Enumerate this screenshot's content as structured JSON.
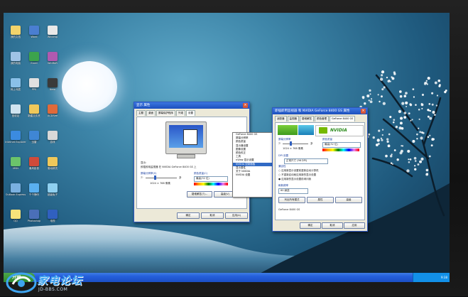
{
  "desktop": {
    "icons": [
      {
        "label": "我的文档",
        "color": "#f2d36b"
      },
      {
        "label": "我的电脑",
        "color": "#9fc3e6"
      },
      {
        "label": "网上邻居",
        "color": "#8ac0e8"
      },
      {
        "label": "回收站",
        "color": "#cfe3f0"
      },
      {
        "label": "Internet Explorer",
        "color": "#3b8be0"
      },
      {
        "label": "MSN",
        "color": "#6bc36a"
      },
      {
        "label": "Outlook Express",
        "color": "#7ab0e0"
      },
      {
        "label": "QQ",
        "color": "#f5e27a"
      },
      {
        "label": "Word",
        "color": "#4a7ed1"
      },
      {
        "label": "Excel",
        "color": "#3ca34c"
      },
      {
        "label": "PPS",
        "color": "#e0e0e0"
      },
      {
        "label": "新建文件夹",
        "color": "#f0c85a"
      },
      {
        "label": "迅雷",
        "color": "#3f86d4"
      },
      {
        "label": "暴风影音",
        "color": "#d04a3a"
      },
      {
        "label": "千千静听",
        "color": "#5ab0f0"
      },
      {
        "label": "Photoshop",
        "color": "#4a6fb8"
      },
      {
        "label": "Winamp",
        "color": "#e8e8e8"
      },
      {
        "label": "WinRAR",
        "color": "#b05ab0"
      },
      {
        "label": "Nero",
        "color": "#3a3a3a"
      },
      {
        "label": "ACDSee",
        "color": "#e06a3a"
      },
      {
        "label": "游戏",
        "color": "#d8d8d8"
      },
      {
        "label": "驱动精灵",
        "color": "#f0c85a"
      },
      {
        "label": "超级兔子",
        "color": "#8fd0f0"
      },
      {
        "label": "电视",
        "color": "#3060c0"
      }
    ]
  },
  "display_props": {
    "title": "显示 属性",
    "tabs": [
      "主题",
      "桌面",
      "屏幕保护程序",
      "外观",
      "设置"
    ],
    "active_tab": "设置",
    "display_label": "显示:",
    "display_value": "即插即用监视器 在 NVIDIA GeForce 8400 GS 上",
    "resolution_label": "屏幕分辨率(S)",
    "resolution_less": "少",
    "resolution_more": "多",
    "resolution_value": "1024 × 768 像素",
    "color_label": "颜色质量(C)",
    "color_value": "最高(32 位)",
    "troubleshoot_btn": "疑难解答(T)...",
    "advanced_btn": "高级(V)",
    "ok_btn": "确定",
    "cancel_btn": "取消",
    "apply_btn": "应用(A)"
  },
  "context_menu": {
    "items": [
      "GeForce 8400 GS",
      "屏幕分辨率",
      "颜色质量",
      "显示器设置",
      "图像设置",
      "颜色校正",
      "工具",
      "nView 显示设置",
      "NVIDIA 控制面板",
      "显示属性",
      "关于 NVIDIA",
      "NVIDIA 设置"
    ],
    "highlight": "NVIDIA 控制面板"
  },
  "nvidia": {
    "title": "即插即用监视器 和 NVIDIA GeForce 8400 GS 属性",
    "tabs": [
      "适配器",
      "监视器",
      "疑难解答",
      "颜色管理",
      "GeForce 8400 GS"
    ],
    "active_tab": "GeForce 8400 GS",
    "logo_text": "NVIDIA",
    "header_label": "GeForce 8400 GS",
    "resolution_label": "屏幕分辨率",
    "resolution_less": "少",
    "resolution_more": "多",
    "resolution_value": "1024 × 768 像素",
    "color_label": "颜色质量",
    "color_value": "最高(32 位)",
    "dpi_label": "DPI 设置",
    "dpi_value": "正常尺寸 (96 DPI)",
    "compat_label": "兼容性",
    "check1": "应用新显示设置前重新启动计算机",
    "check2": "不重新启动就应用新的显示设置",
    "check3": "应用新的显示设置前询问我",
    "refresh_label": "刷新频率",
    "refresh_value": "60 赫兹",
    "btn_list": "列出所有模式",
    "btn_props": "属性",
    "btn_adv": "高级",
    "ok_btn": "确定",
    "cancel_btn": "取消",
    "apply_btn": "应用"
  },
  "taskbar": {
    "start_label": "开始",
    "clock": "9:38"
  },
  "watermark": {
    "brand": "家电论坛",
    "url": "JD-BBS.COM"
  }
}
